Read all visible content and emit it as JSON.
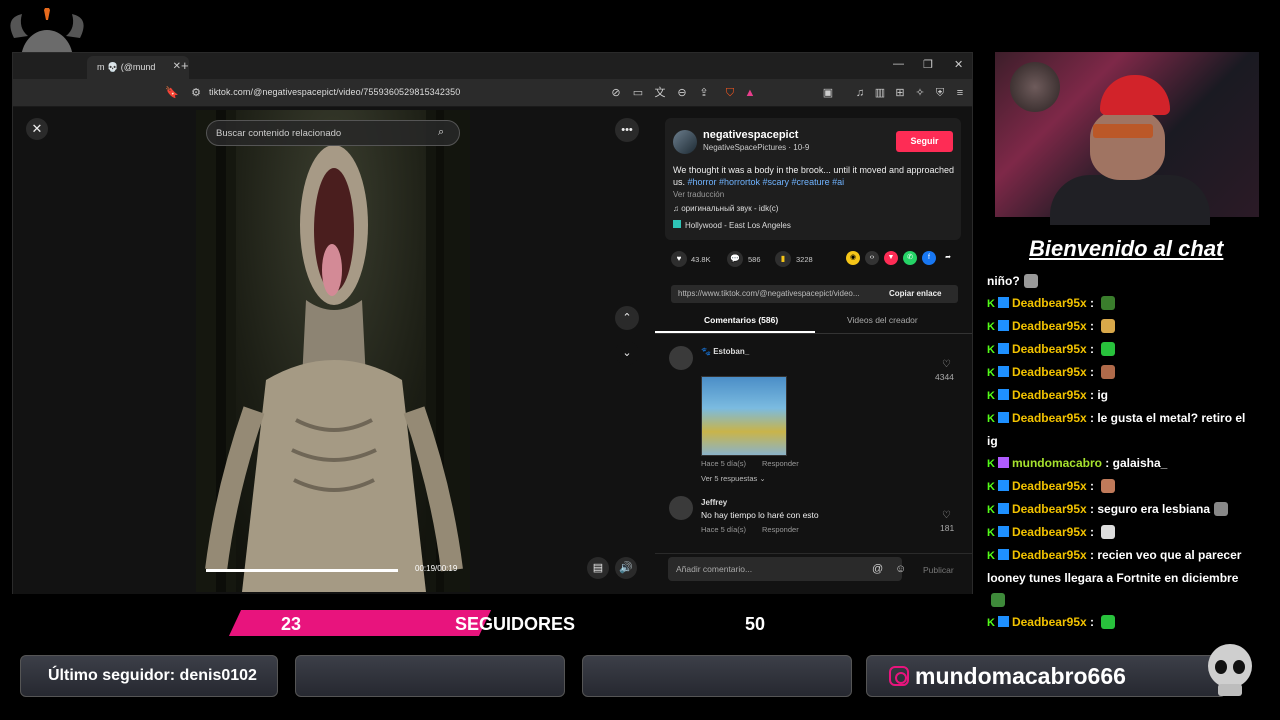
{
  "browser": {
    "tab_title": "m 💀 (@mund",
    "url": "tiktok.com/@negativespacepict/video/7559360529815342350"
  },
  "video": {
    "search_placeholder": "Buscar contenido relacionado",
    "time": "00:19/00:19",
    "progress": 1.0
  },
  "post": {
    "username": "negativespacepict",
    "display_meta": "NegativeSpacePictures · 10-9",
    "follow_label": "Seguir",
    "description": "We thought it was a body in the brook... until it moved and approached us. ",
    "hashtags": "#horror #horrortok #scary #creature #ai",
    "translate": "Ver traducción",
    "sound": "♫ оригинальный звук - idk(c)",
    "location": "Hollywood - East Los Angeles",
    "likes": "43.8K",
    "comments": "586",
    "saves": "3228",
    "link": "https://www.tiktok.com/@negativespacepict/video...",
    "copy_label": "Copiar enlace"
  },
  "tabs": {
    "comments": "Comentarios (586)",
    "videos": "Videos del creador"
  },
  "comments": [
    {
      "name": "Estoban_",
      "meta": "Hace 5 día(s)",
      "reply": "Responder",
      "likes": "4344",
      "more": "Ver 5 respuestas ⌄"
    },
    {
      "name": "Jeffrey",
      "text": "No hay tiempo lo haré con esto",
      "meta": "Hace 5 día(s)",
      "reply": "Responder",
      "likes": "181"
    }
  ],
  "comment_input": {
    "placeholder": "Añadir comentario...",
    "publish": "Publicar"
  },
  "chat": {
    "title": "Bienvenido al chat",
    "first_line": "niño?",
    "lines": [
      {
        "user": "Deadbear95x",
        "msg": "",
        "emote": "#3a7d2c"
      },
      {
        "user": "Deadbear95x",
        "msg": "",
        "emote": "#d8a84a"
      },
      {
        "user": "Deadbear95x",
        "msg": "",
        "emote": "#28c23c"
      },
      {
        "user": "Deadbear95x",
        "msg": "",
        "emote": "#b06a4a"
      },
      {
        "user": "Deadbear95x",
        "msg": "ig",
        "emote": ""
      },
      {
        "user": "Deadbear95x",
        "msg": "le gusta el metal? retiro el",
        "emote": ""
      },
      {
        "user": "",
        "msg": "ig",
        "emote": ""
      },
      {
        "user": "mundomacabro",
        "msg": "galaisha_",
        "emote": ""
      },
      {
        "user": "Deadbear95x",
        "msg": "",
        "emote": "#c07a5a"
      },
      {
        "user": "Deadbear95x",
        "msg": "seguro era lesbiana",
        "emote": "#888888"
      },
      {
        "user": "Deadbear95x",
        "msg": "",
        "emote": "#dddddd"
      },
      {
        "user": "Deadbear95x",
        "msg": "recien veo que al parecer",
        "emote": ""
      },
      {
        "user": "",
        "msg": "looney tunes llegara a Fortnite en diciembre",
        "emote": ""
      },
      {
        "user": "",
        "msg": "",
        "emote": "#3e8a3a"
      },
      {
        "user": "Deadbear95x",
        "msg": "",
        "emote": "#28c23c"
      }
    ]
  },
  "overlay": {
    "followers_current": "23",
    "followers_label": "SEGUIDORES",
    "followers_goal": "50",
    "last_follower": "Último seguidor: denis0102",
    "instagram": "mundomacabro666"
  },
  "colors": {
    "accent": "#e8147d",
    "tiktok_red": "#fe2c55"
  }
}
